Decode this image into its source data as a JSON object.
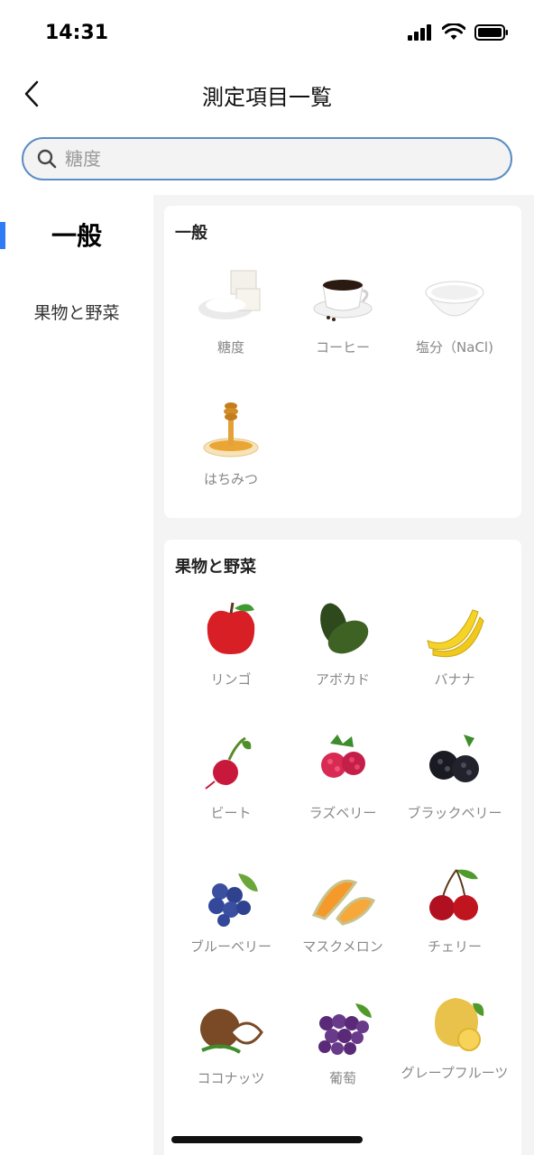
{
  "status": {
    "time": "14:31"
  },
  "nav": {
    "title": "測定項目一覧"
  },
  "search": {
    "placeholder": "糖度"
  },
  "sidebar": {
    "items": [
      {
        "label": "一般",
        "active": true
      },
      {
        "label": "果物と野菜",
        "active": false
      }
    ]
  },
  "sections": [
    {
      "title": "一般",
      "items": [
        {
          "label": "糖度",
          "icon": "sugar-cubes-icon"
        },
        {
          "label": "コーヒー",
          "icon": "coffee-cup-icon"
        },
        {
          "label": "塩分（NaCl)",
          "icon": "salt-bowl-icon"
        },
        {
          "label": "はちみつ",
          "icon": "honey-icon"
        }
      ]
    },
    {
      "title": "果物と野菜",
      "items": [
        {
          "label": "リンゴ",
          "icon": "apple-icon"
        },
        {
          "label": "アボカド",
          "icon": "avocado-icon"
        },
        {
          "label": "バナナ",
          "icon": "banana-icon"
        },
        {
          "label": "ビート",
          "icon": "beet-icon"
        },
        {
          "label": "ラズベリー",
          "icon": "raspberry-icon"
        },
        {
          "label": "ブラックベリー",
          "icon": "blackberry-icon"
        },
        {
          "label": "ブルーベリー",
          "icon": "blueberry-icon"
        },
        {
          "label": "マスクメロン",
          "icon": "melon-icon"
        },
        {
          "label": "チェリー",
          "icon": "cherry-icon"
        },
        {
          "label": "ココナッツ",
          "icon": "coconut-icon"
        },
        {
          "label": "葡萄",
          "icon": "grape-icon"
        },
        {
          "label": "グレープフルーツ",
          "icon": "grapefruit-icon"
        }
      ]
    }
  ],
  "colors": {
    "accent": "#2f7cf6",
    "search_border": "#5b8ec4"
  }
}
